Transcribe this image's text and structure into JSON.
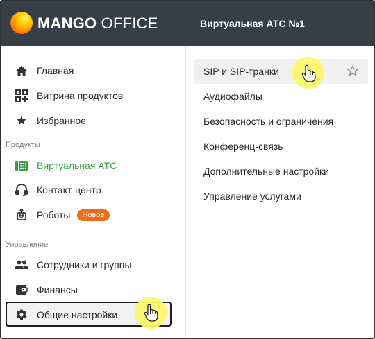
{
  "header": {
    "logo_bold": "MANGO",
    "logo_light": " OFFICE",
    "title": "Виртуальная АТС №1"
  },
  "sidebar": {
    "items_top": [
      {
        "label": "Главная",
        "icon": "home-icon"
      },
      {
        "label": "Витрина продуктов",
        "icon": "grid-icon"
      },
      {
        "label": "Избранное",
        "icon": "star-icon"
      }
    ],
    "section_products": "Продукты",
    "items_products": [
      {
        "label": "Виртуальная АТС",
        "icon": "pbx-icon",
        "active": true
      },
      {
        "label": "Контакт-центр",
        "icon": "headset-icon"
      },
      {
        "label": "Роботы",
        "icon": "robot-icon",
        "badge": "Новое"
      }
    ],
    "section_management": "Управление",
    "items_management": [
      {
        "label": "Сотрудники и группы",
        "icon": "people-icon"
      },
      {
        "label": "Финансы",
        "icon": "wallet-icon"
      },
      {
        "label": "Общие настройки",
        "icon": "gear-icon",
        "selected": true
      }
    ]
  },
  "submenu": {
    "items": [
      {
        "label": "SIP и SIP-транки",
        "highlighted": true
      },
      {
        "label": "Аудиофайлы"
      },
      {
        "label": "Безопасность и ограничения"
      },
      {
        "label": "Конференц-связь"
      },
      {
        "label": "Дополнительные настройки"
      },
      {
        "label": "Управление услугами"
      }
    ]
  },
  "colors": {
    "header_bg": "#363f47",
    "accent_green": "#3f9f48",
    "badge_orange": "#f06b1a",
    "cursor_highlight": "#fbf76a"
  }
}
